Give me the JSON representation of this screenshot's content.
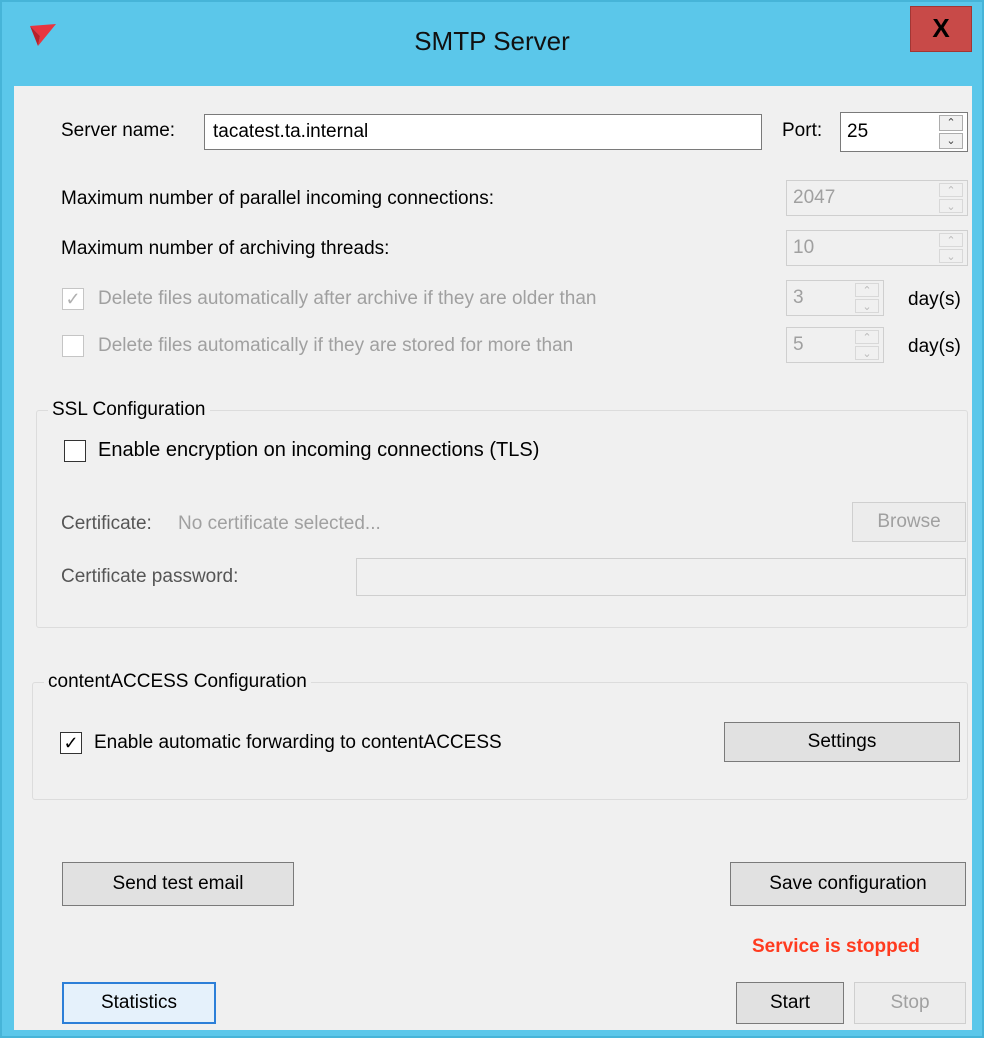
{
  "window": {
    "title": "SMTP Server",
    "close_label": "X"
  },
  "server": {
    "name_label": "Server name:",
    "name_value": "tacatest.ta.internal",
    "port_label": "Port:",
    "port_value": "25"
  },
  "limits": {
    "parallel_label": "Maximum number of parallel incoming connections:",
    "parallel_value": "2047",
    "threads_label": "Maximum number of archiving threads:",
    "threads_value": "10"
  },
  "deletion": {
    "after_archive_label": "Delete files automatically after archive if they are older than",
    "after_archive_checked": true,
    "after_archive_value": "3",
    "stored_label": "Delete files automatically if they are stored for more than",
    "stored_checked": false,
    "stored_value": "5",
    "unit": "day(s)"
  },
  "ssl": {
    "group_title": "SSL Configuration",
    "enable_label": "Enable encryption on incoming connections (TLS)",
    "enable_checked": false,
    "certificate_label": "Certificate:",
    "certificate_value": "No certificate selected...",
    "browse_label": "Browse",
    "password_label": "Certificate password:",
    "password_value": ""
  },
  "content_access": {
    "group_title": "contentACCESS Configuration",
    "forward_label": "Enable automatic forwarding to contentACCESS",
    "forward_checked": true,
    "settings_label": "Settings"
  },
  "actions": {
    "send_test_label": "Send test email",
    "save_label": "Save configuration",
    "status_text": "Service is stopped",
    "statistics_label": "Statistics",
    "start_label": "Start",
    "stop_label": "Stop"
  },
  "colors": {
    "titlebar": "#5bc7ea",
    "close": "#c84a48",
    "status": "#ff3b1f",
    "logo": "#e8353f"
  },
  "icons": {
    "app": "red-paper-plane-icon",
    "checked": "✓",
    "spin_up": "⌃",
    "spin_down": "⌄"
  }
}
